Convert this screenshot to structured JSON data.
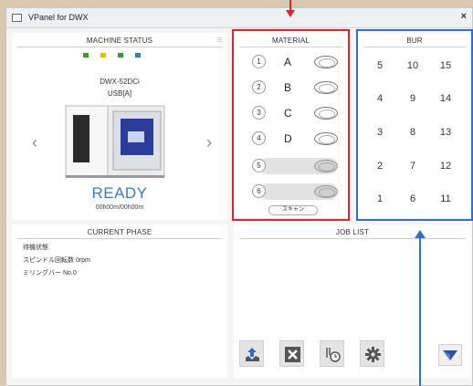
{
  "window": {
    "title": "VPanel for DWX",
    "close": "×"
  },
  "machine_status": {
    "title": "MACHINE STATUS",
    "model": "DWX-52DCi",
    "connection": "USB[A]",
    "status": "READY",
    "time": "00h00m/00h00m",
    "indicator_colors": [
      "#3a9a3a",
      "#e5c000",
      "#3a9a3a",
      "#3a78c9"
    ]
  },
  "material": {
    "title": "MATERIAL",
    "slots": [
      {
        "num": "1",
        "letter": "A"
      },
      {
        "num": "2",
        "letter": "B"
      },
      {
        "num": "3",
        "letter": "C"
      },
      {
        "num": "4",
        "letter": "D"
      },
      {
        "num": "5",
        "letter": ""
      },
      {
        "num": "6",
        "letter": ""
      }
    ],
    "scan_label": "スキャン"
  },
  "bur": {
    "title": "BUR",
    "rows": [
      [
        "5",
        "10",
        "15"
      ],
      [
        "4",
        "9",
        "14"
      ],
      [
        "3",
        "8",
        "13"
      ],
      [
        "2",
        "7",
        "12"
      ],
      [
        "1",
        "6",
        "11"
      ]
    ]
  },
  "current_phase": {
    "title": "CURRENT PHASE",
    "lines": [
      "待機状態",
      "スピンドル回転数 0rpm",
      "ミリングバー No.0"
    ]
  },
  "job_list": {
    "title": "JOB LIST"
  },
  "toolbar": [
    "upload-icon",
    "close-icon",
    "timer-icon",
    "gear-icon",
    "roland-logo-icon"
  ],
  "annotation_colors": {
    "red": "#e8202a",
    "blue": "#2f6fcf"
  }
}
